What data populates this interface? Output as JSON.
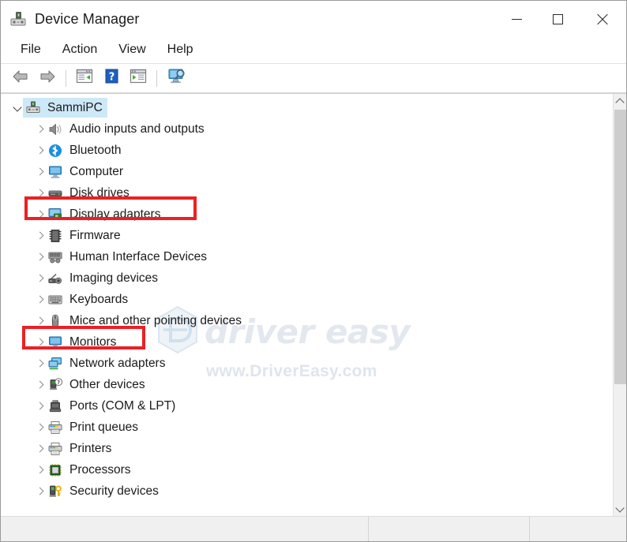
{
  "window": {
    "title": "Device Manager",
    "icon": "device-manager-icon",
    "caption": {
      "minimize": "minimize-icon",
      "maximize": "maximize-icon",
      "close": "close-icon"
    }
  },
  "menubar": {
    "items": [
      {
        "label": "File"
      },
      {
        "label": "Action"
      },
      {
        "label": "View"
      },
      {
        "label": "Help"
      }
    ]
  },
  "toolbar": {
    "buttons": [
      {
        "name": "back-icon",
        "tooltip": "Back"
      },
      {
        "name": "forward-icon",
        "tooltip": "Forward"
      },
      {
        "name": "properties-icon",
        "tooltip": "Properties"
      },
      {
        "name": "help-icon",
        "tooltip": "Help"
      },
      {
        "name": "update-driver-icon",
        "tooltip": "Update Driver Software"
      },
      {
        "name": "scan-hardware-changes-icon",
        "tooltip": "Scan for hardware changes"
      }
    ]
  },
  "tree": {
    "root": {
      "label": "SammiPC",
      "icon": "computer-device-icon",
      "expanded": true,
      "selected": true
    },
    "nodes": [
      {
        "label": "Audio inputs and outputs",
        "icon": "speaker-icon",
        "expanded": false,
        "highlighted": false
      },
      {
        "label": "Bluetooth",
        "icon": "bluetooth-icon",
        "expanded": false,
        "highlighted": false
      },
      {
        "label": "Computer",
        "icon": "monitor-icon",
        "expanded": false,
        "highlighted": false
      },
      {
        "label": "Disk drives",
        "icon": "disk-drive-icon",
        "expanded": false,
        "highlighted": false
      },
      {
        "label": "Display adapters",
        "icon": "display-adapter-icon",
        "expanded": false,
        "highlighted": true
      },
      {
        "label": "Firmware",
        "icon": "firmware-chip-icon",
        "expanded": false,
        "highlighted": false
      },
      {
        "label": "Human Interface Devices",
        "icon": "hid-icon",
        "expanded": false,
        "highlighted": false
      },
      {
        "label": "Imaging devices",
        "icon": "camera-icon",
        "expanded": false,
        "highlighted": false
      },
      {
        "label": "Keyboards",
        "icon": "keyboard-icon",
        "expanded": false,
        "highlighted": false
      },
      {
        "label": "Mice and other pointing devices",
        "icon": "mouse-icon",
        "expanded": false,
        "highlighted": false
      },
      {
        "label": "Monitors",
        "icon": "monitor-icon",
        "expanded": false,
        "highlighted": true
      },
      {
        "label": "Network adapters",
        "icon": "network-adapter-icon",
        "expanded": false,
        "highlighted": false
      },
      {
        "label": "Other devices",
        "icon": "other-device-icon",
        "expanded": false,
        "highlighted": false
      },
      {
        "label": "Ports (COM & LPT)",
        "icon": "port-icon",
        "expanded": false,
        "highlighted": false
      },
      {
        "label": "Print queues",
        "icon": "printer-icon",
        "expanded": false,
        "highlighted": false
      },
      {
        "label": "Printers",
        "icon": "printer-icon",
        "expanded": false,
        "highlighted": false
      },
      {
        "label": "Processors",
        "icon": "processor-icon",
        "expanded": false,
        "highlighted": false
      },
      {
        "label": "Security devices",
        "icon": "security-device-icon",
        "expanded": false,
        "highlighted": false
      }
    ]
  },
  "watermark": {
    "brand": "driver easy",
    "url": "www.DriverEasy.com",
    "logo": "driver-easy-hex-logo"
  },
  "statusbar": {
    "pane1": "",
    "pane2": "",
    "pane3": ""
  },
  "scrollbar": {
    "up": "scroll-up-icon",
    "down": "scroll-down-icon"
  },
  "colors": {
    "annotation": "#ec2024",
    "selection": "#cde8f7",
    "accent_blue": "#2f9ee0"
  }
}
